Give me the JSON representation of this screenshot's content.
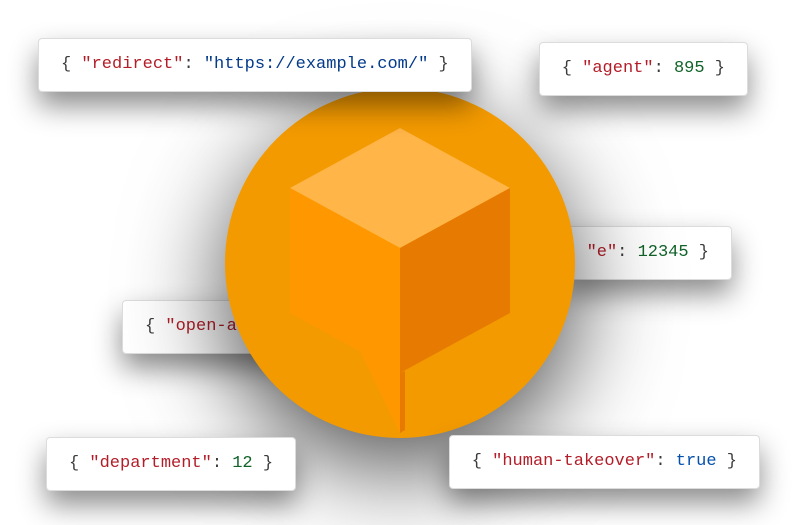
{
  "snippets": [
    {
      "pos": "pos-1",
      "key": "redirect",
      "value": "https://example.com/",
      "type": "string"
    },
    {
      "pos": "pos-2",
      "key": "agent",
      "value": 895,
      "type": "number"
    },
    {
      "pos": "pos-3",
      "key": "e",
      "value": 12345,
      "type": "number",
      "partial_left": true
    },
    {
      "pos": "pos-4",
      "key": "open-article",
      "value": null,
      "type": "truncated"
    },
    {
      "pos": "pos-5",
      "key": "department",
      "value": 12,
      "type": "number"
    },
    {
      "pos": "pos-6",
      "key": "human-takeover",
      "value": true,
      "type": "bool"
    }
  ],
  "icon": {
    "name": "chat-cube-icon",
    "circle_color": "#f39a00",
    "cube_light": "#ff9800",
    "cube_dark": "#e77a00",
    "cube_top": "#ffb547"
  }
}
